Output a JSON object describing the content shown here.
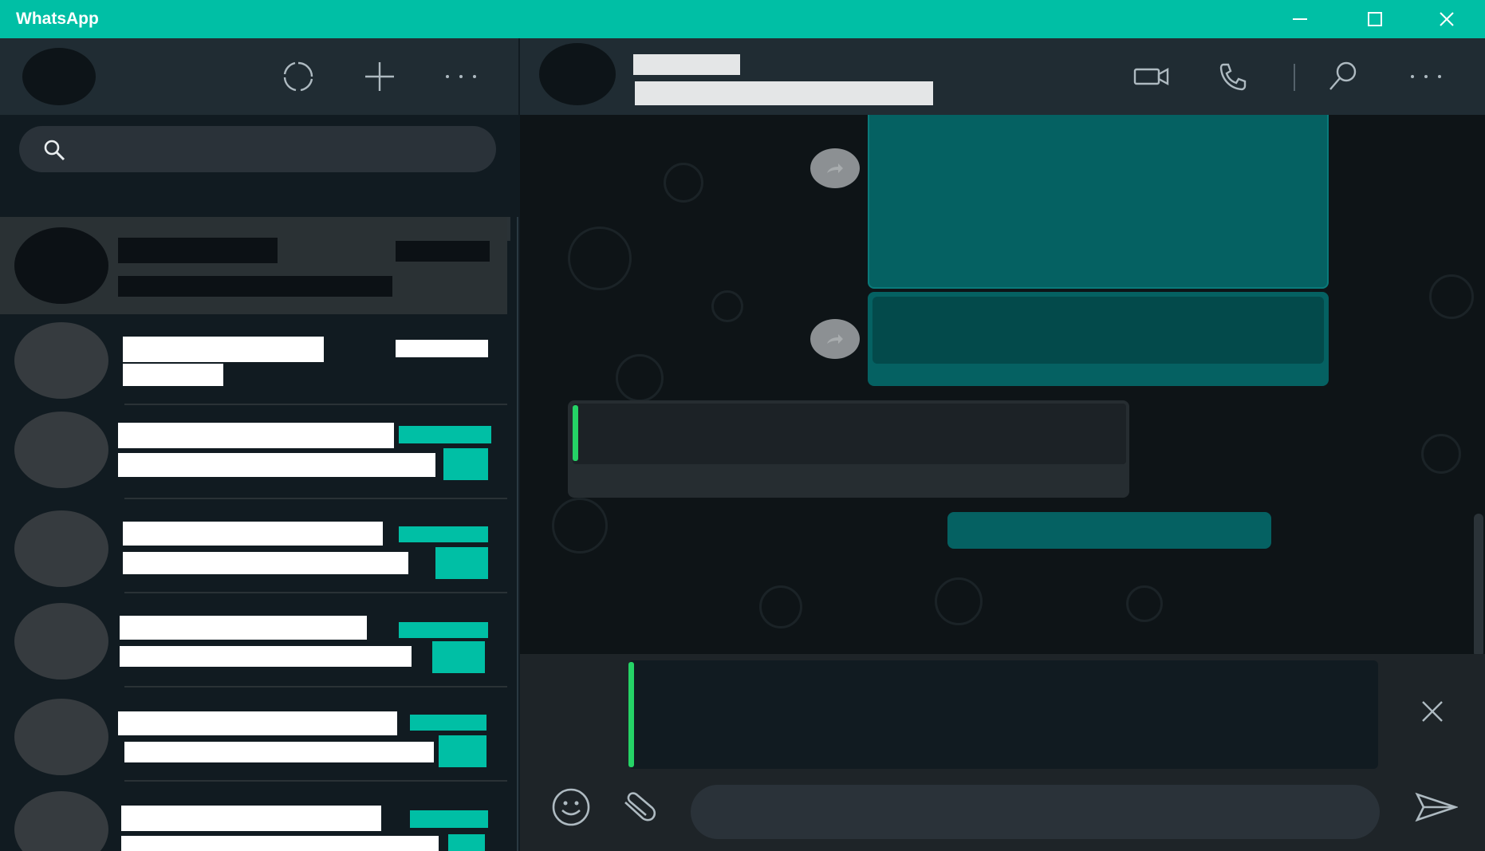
{
  "window": {
    "title": "WhatsApp",
    "controls": [
      "minimize",
      "maximize",
      "close"
    ]
  },
  "colors": {
    "titlebar": "#00bfa5",
    "panel_header": "#202c33",
    "outgoing_bubble": "#056162",
    "quote_accent": "#25d366",
    "unread_badge": "#00bfa5"
  },
  "sidebar": {
    "header_icons": [
      "status-icon",
      "new-chat-icon",
      "menu-icon"
    ],
    "search": {
      "icon": "search-icon",
      "placeholder": "",
      "value": ""
    },
    "chats_redacted": true
  },
  "conversation": {
    "header_icons": [
      "video-call-icon",
      "voice-call-icon",
      "search-icon",
      "menu-icon"
    ],
    "reply_preview_redacted": true
  },
  "composer": {
    "icons": [
      "emoji-icon",
      "attach-icon",
      "send-icon",
      "close-icon"
    ],
    "placeholder": "",
    "value": ""
  }
}
